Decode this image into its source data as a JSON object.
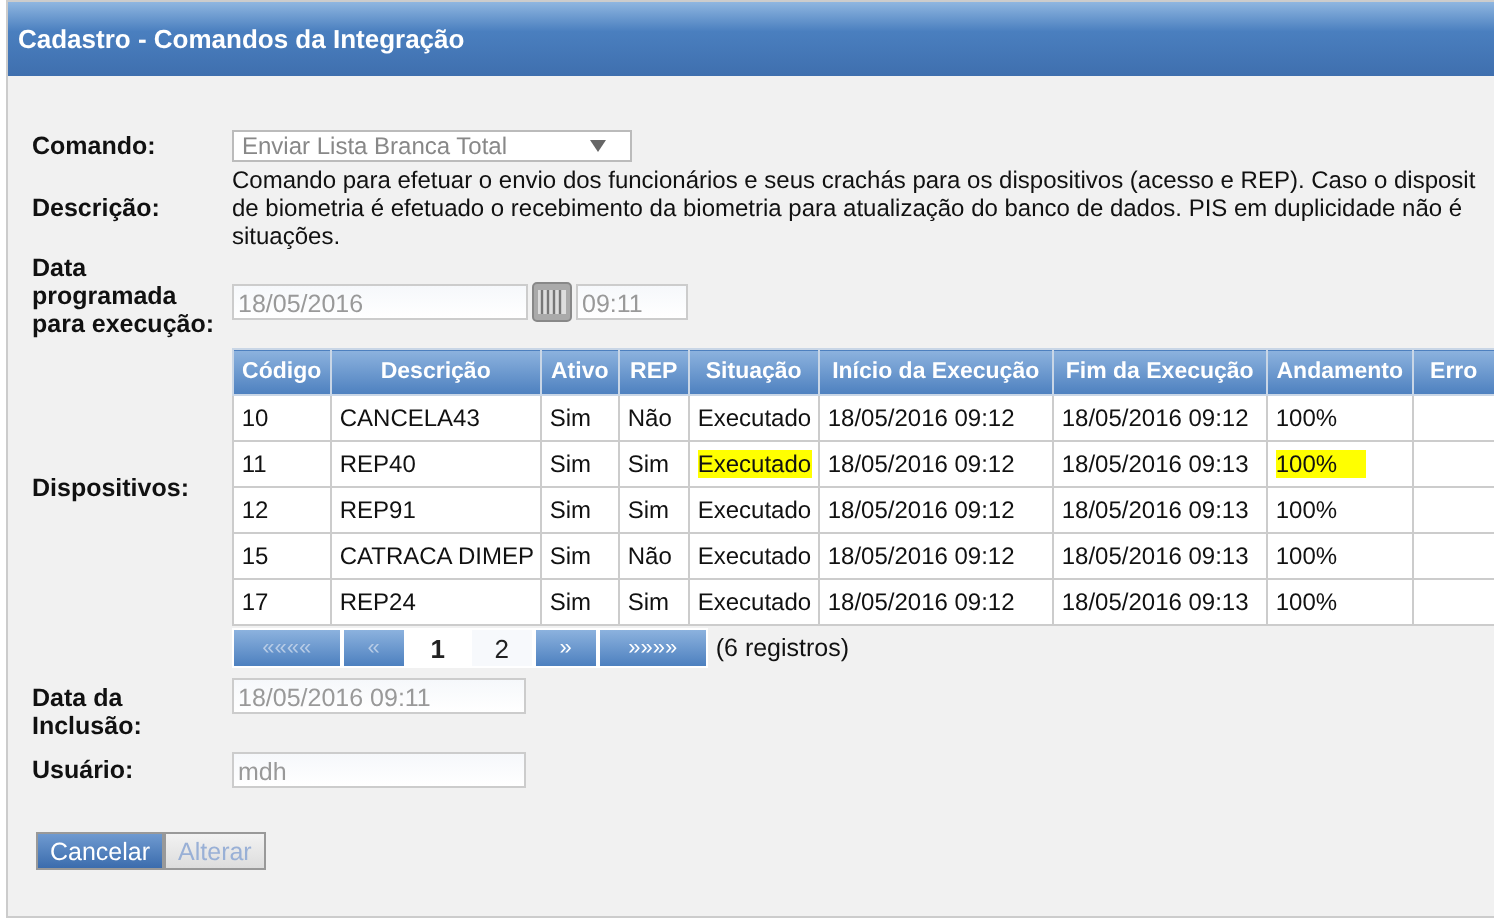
{
  "window": {
    "title": "Cadastro - Comandos da Integração"
  },
  "form": {
    "comando": {
      "label": "Comando:",
      "value": "Enviar Lista Branca Total",
      "disabled": true
    },
    "descricao": {
      "label": "Descrição:",
      "lines": [
        "Comando para efetuar o envio dos funcionários e seus crachás para os dispositivos (acesso e REP). Caso o disposit",
        "de biometria é efetuado o recebimento da biometria para atualização do banco de dados. PIS em duplicidade não é",
        "situações."
      ]
    },
    "data_programada": {
      "label": "Data programada para execução:",
      "date": "18/05/2016",
      "time": "09:11"
    },
    "dispositivos": {
      "label": "Dispositivos:",
      "table": {
        "columns": [
          "Código",
          "Descrição",
          "Ativo",
          "REP",
          "Situação",
          "Início da Execução",
          "Fim da Execução",
          "Andamento",
          "Erro"
        ],
        "rows": [
          {
            "cells": [
              "10",
              "CANCELA43",
              "Sim",
              "Não",
              "Executado",
              "18/05/2016 09:12",
              "18/05/2016 09:12",
              "100%",
              ""
            ],
            "highlighted": false
          },
          {
            "cells": [
              "11",
              "REP40",
              "Sim",
              "Sim",
              "Executado",
              "18/05/2016 09:12",
              "18/05/2016 09:13",
              "100%",
              ""
            ],
            "highlighted": true
          },
          {
            "cells": [
              "12",
              "REP91",
              "Sim",
              "Sim",
              "Executado",
              "18/05/2016 09:12",
              "18/05/2016 09:13",
              "100%",
              ""
            ],
            "highlighted": false
          },
          {
            "cells": [
              "15",
              "CATRACA DIMEP",
              "Sim",
              "Não",
              "Executado",
              "18/05/2016 09:12",
              "18/05/2016 09:13",
              "100%",
              ""
            ],
            "highlighted": false
          },
          {
            "cells": [
              "17",
              "REP24",
              "Sim",
              "Sim",
              "Executado",
              "18/05/2016 09:12",
              "18/05/2016 09:13",
              "100%",
              ""
            ],
            "highlighted": false
          }
        ]
      },
      "pager": {
        "buttons": [
          {
            "label": "««««",
            "kind": "nav",
            "disabled": true
          },
          {
            "label": "«",
            "kind": "nav",
            "disabled": true
          },
          {
            "label": "1",
            "kind": "page",
            "selected": true
          },
          {
            "label": "2",
            "kind": "page",
            "selected": false
          },
          {
            "label": "»",
            "kind": "nav",
            "disabled": false
          },
          {
            "label": "»»»»",
            "kind": "nav",
            "disabled": false
          }
        ],
        "count": "(6 registros)"
      }
    },
    "data_inclusao": {
      "label": "Data da Inclusão:",
      "value": "18/05/2016 09:11"
    },
    "usuario": {
      "label": "Usuário:",
      "value": "mdh"
    }
  },
  "buttons": [
    {
      "label": "Cancelar",
      "disabled": false
    },
    {
      "label": "Alterar",
      "disabled": true
    }
  ]
}
